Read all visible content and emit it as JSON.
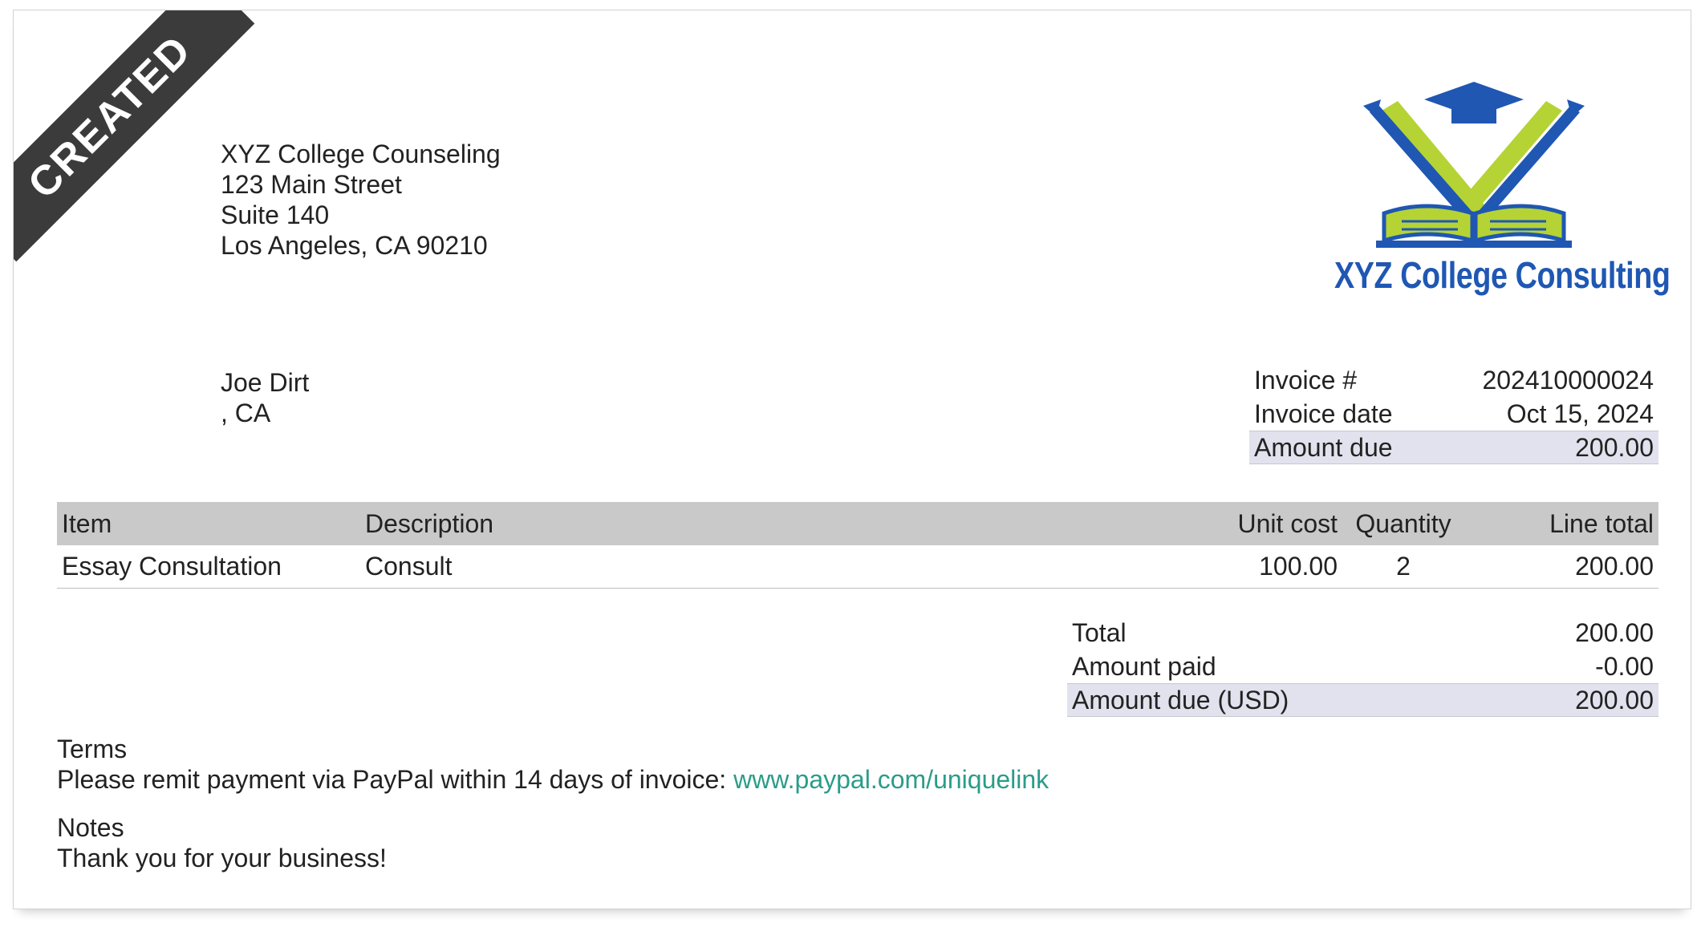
{
  "status_ribbon": "CREATED",
  "sender": {
    "name": "XYZ College Counseling",
    "address_line1": "123 Main Street",
    "address_line2": "Suite 140",
    "city_state_zip": "Los Angeles, CA 90210"
  },
  "logo": {
    "text": "XYZ College Consulting",
    "colors": {
      "blue": "#1f57b3",
      "green": "#b5d334"
    }
  },
  "client": {
    "name": "Joe Dirt",
    "location": ", CA"
  },
  "invoice_meta": {
    "number_label": "Invoice #",
    "number_value": "202410000024",
    "date_label": "Invoice date",
    "date_value": "Oct 15, 2024",
    "amount_due_label": "Amount due",
    "amount_due_value": "200.00"
  },
  "items_table": {
    "headers": {
      "item": "Item",
      "description": "Description",
      "unit_cost": "Unit cost",
      "quantity": "Quantity",
      "line_total": "Line total"
    },
    "rows": [
      {
        "item": "Essay Consultation",
        "description": "Consult",
        "unit_cost": "100.00",
        "quantity": "2",
        "line_total": "200.00"
      }
    ]
  },
  "totals": {
    "total_label": "Total",
    "total_value": "200.00",
    "paid_label": "Amount paid",
    "paid_value": "-0.00",
    "due_label": "Amount due (USD)",
    "due_value": "200.00"
  },
  "terms": {
    "heading": "Terms",
    "text": "Please remit payment via PayPal within 14 days of invoice: ",
    "link": "www.paypal.com/uniquelink"
  },
  "notes": {
    "heading": "Notes",
    "text": "Thank you for your business!"
  },
  "colors": {
    "ribbon": "#3b3b3b",
    "highlight_row": "#e1e2ed",
    "table_header": "#c9c9c9",
    "link": "#2a9c8a"
  }
}
